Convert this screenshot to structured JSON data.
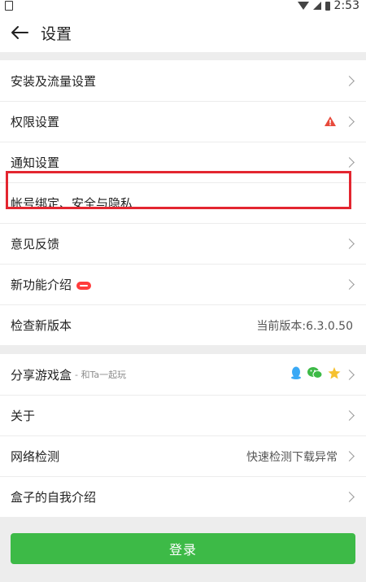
{
  "status_bar": {
    "time": "2:53"
  },
  "header": {
    "title": "设置"
  },
  "settings_group_1": [
    {
      "label": "安装及流量设置"
    },
    {
      "label": "权限设置",
      "warning": true
    },
    {
      "label": "通知设置"
    },
    {
      "label": "帐号绑定、安全与隐私",
      "highlighted": true
    },
    {
      "label": "意见反馈"
    },
    {
      "label": "新功能介绍",
      "badge": "new"
    },
    {
      "label": "检查新版本",
      "value": "当前版本:6.3.0.50"
    }
  ],
  "settings_group_2": [
    {
      "label": "分享游戏盒",
      "sub": " - 和Ta一起玩",
      "share_icons": [
        "qq-icon",
        "wechat-icon",
        "qzone-star-icon"
      ]
    },
    {
      "label": "关于"
    },
    {
      "label": "网络检测",
      "value": "快速检测下载异常"
    },
    {
      "label": "盒子的自我介绍"
    }
  ],
  "login_button": {
    "label": "登录"
  },
  "colors": {
    "accent_green": "#3dba47",
    "highlight_red": "#e32630",
    "warning_red": "#e84a3c",
    "qq_blue": "#3aa9f5",
    "wechat_green": "#3dba47",
    "star_yellow": "#f6c12f"
  }
}
